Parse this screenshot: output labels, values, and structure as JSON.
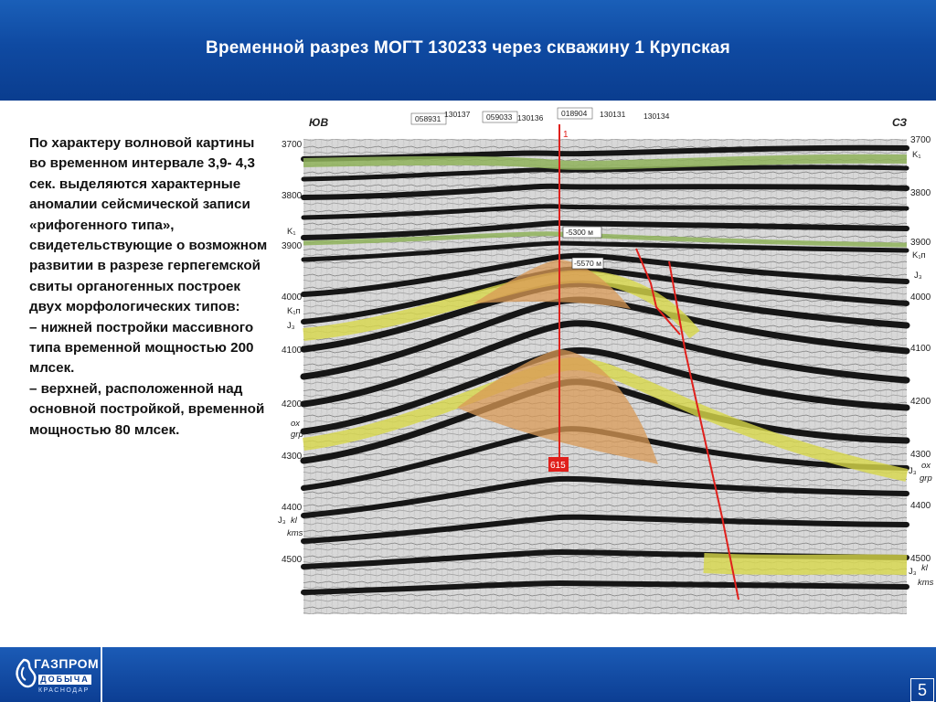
{
  "header": {
    "title": "Временной разрез МОГТ 130233 через скважину 1 Крупская"
  },
  "body": {
    "paragraphs": [
      " По характеру волновой картины во временном интервале 3,9- 4,3 сек. выделяются характерные аномалии сейсмической записи «рифогенного типа», свидетельствующие о возможном развитии  в разрезе герпегемской свиты органогенных построек двух морфологических типов:",
      " – нижней постройки массивного типа временной мощностью 200 млсек.",
      " – верхней, расположенной над основной постройкой, временной мощностью 80 млсек."
    ]
  },
  "section": {
    "dir_left": "ЮВ",
    "dir_right": "СЗ",
    "lines": [
      "058931",
      "130137",
      "059033",
      "130136",
      "018904",
      "130131",
      "130134"
    ],
    "well": "1",
    "time_ticks": [
      "3700",
      "3800",
      "3900",
      "4000",
      "4100",
      "4200",
      "4300",
      "4400",
      "4500"
    ],
    "depth_labels": [
      "-5300 м",
      "-5570 м"
    ],
    "bottom_label": "615",
    "left_horizons": {
      "k1": "K₁",
      "k1p_l": "K₁п",
      "j3_l": "J₃",
      "ox_l": "ox",
      "grp_l": "grp",
      "j3b_l": "J₃",
      "kl_l": "kl",
      "kms_l": "kms"
    },
    "right_horizons": {
      "k1": "K₁",
      "k1p": "K₁п",
      "j3": "J₃",
      "j3ox": "J₃",
      "ox": "ox",
      "grp": "grp",
      "j3kl": "J₃",
      "kl": "kl",
      "kms": "kms"
    },
    "colors": {
      "green": "#8fb35a",
      "yellow": "#d8d84a",
      "orange": "#d99a55",
      "fault": "#e0201c"
    }
  },
  "footer": {
    "logo": "ГАЗПРОМ",
    "logo_sub": "ДОБЫЧА",
    "logo_city": "КРАСНОДАР",
    "page_number": "5"
  }
}
